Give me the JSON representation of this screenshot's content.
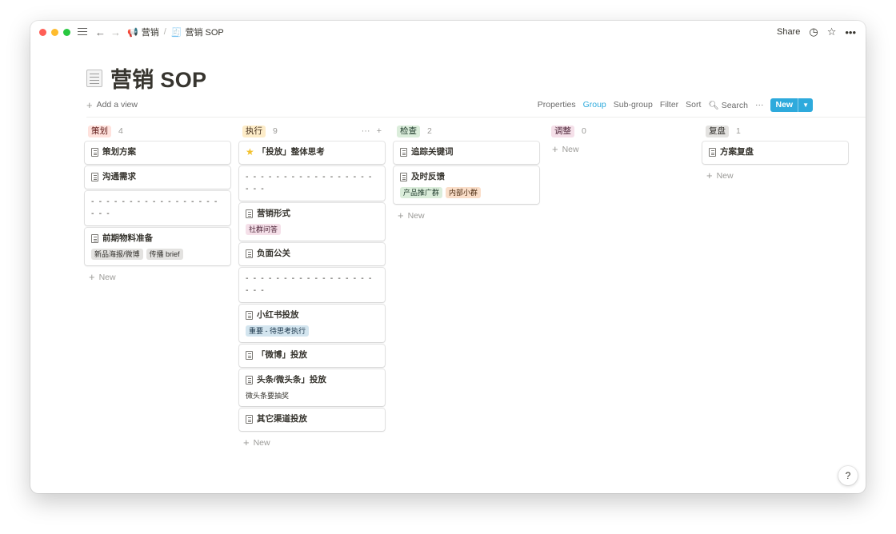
{
  "breadcrumb": {
    "parent": "营销",
    "separator": "/",
    "current": "营销 SOP"
  },
  "topbar": {
    "share": "Share"
  },
  "page": {
    "title": "营销 SOP"
  },
  "views": {
    "add_view": "Add a view",
    "properties": "Properties",
    "group": "Group",
    "subgroup": "Sub-group",
    "filter": "Filter",
    "sort": "Sort",
    "search": "Search",
    "more": "···",
    "new": "New"
  },
  "colors": {
    "accent": "#2eaadc",
    "red_bg": "#ffe2dd",
    "red_fg": "#5d1715",
    "yellow_bg": "#fdecc8",
    "yellow_fg": "#402c1b",
    "green_bg": "#dbeddb",
    "green_fg": "#1c3829",
    "pink_bg": "#f5e0e9",
    "pink_fg": "#4c2337",
    "gray_bg": "#e3e2e0",
    "gray_fg": "#32302c",
    "blue_bg": "#d3e5ef",
    "blue_fg": "#183347",
    "orange_bg": "#fadec9",
    "orange_fg": "#49290e"
  },
  "add_new_label": "New",
  "columns": [
    {
      "name": "策划",
      "count": "4",
      "cards": [
        {
          "title": "策划方案"
        },
        {
          "title": "沟通需求"
        },
        {
          "title": "- - - - - - - - - - - - - - - - - - - -"
        },
        {
          "title": "前期物料准备",
          "tag1": "新品海报/微博",
          "tag2": "传播 brief"
        }
      ]
    },
    {
      "name": "执行",
      "count": "9",
      "more": "···",
      "plus": "+",
      "cards": [
        {
          "title": "「投放」整体思考"
        },
        {
          "title": "- - - - - - - - - - - - - - - - - - - -"
        },
        {
          "title": "营销形式",
          "tag1": "社群问答"
        },
        {
          "title": "负面公关"
        },
        {
          "title": "- - - - - - - - - - - - - - - - - - - -"
        },
        {
          "title": "小红书投放",
          "tag1": "重要 - 待思考执行"
        },
        {
          "title": "「微博」投放"
        },
        {
          "title": "头条/微头条」投放",
          "text": "微头条要抽奖"
        },
        {
          "title": "其它渠道投放"
        }
      ]
    },
    {
      "name": "检查",
      "count": "2",
      "cards": [
        {
          "title": "追踪关键词"
        },
        {
          "title": "及时反馈",
          "tag1": "产品推广群",
          "tag2": "内部小群"
        }
      ]
    },
    {
      "name": "调整",
      "count": "0",
      "cards": []
    },
    {
      "name": "复盘",
      "count": "1",
      "cards": [
        {
          "title": "方案复盘"
        }
      ]
    }
  ],
  "help": "?"
}
